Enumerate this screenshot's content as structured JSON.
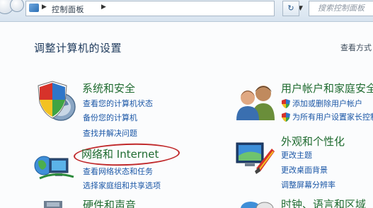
{
  "address_bar": {
    "path": "控制面板",
    "search_placeholder": "搜索控制面板"
  },
  "header": {
    "title": "调整计算机的设置",
    "view_by": "查看方式"
  },
  "categories": {
    "system_security": {
      "title": "系统和安全",
      "links": [
        "查看您的计算机状态",
        "备份您的计算机",
        "查找并解决问题"
      ]
    },
    "network": {
      "title": "网络和 Internet",
      "links": [
        "查看网络状态和任务",
        "选择家庭组和共享选项"
      ]
    },
    "hardware": {
      "title": "硬件和声音"
    },
    "user_accounts": {
      "title": "用户帐户和家庭安全",
      "links": [
        "添加或删除用户帐户",
        "为所有用户设置家长控制"
      ]
    },
    "appearance": {
      "title": "外观和个性化",
      "links": [
        "更改主题",
        "更改桌面背景",
        "调整屏幕分辨率"
      ]
    },
    "clock": {
      "title": "时钟、语言和区域"
    }
  },
  "colors": {
    "category_title": "#1f6b30",
    "link": "#1a56a6",
    "highlight": "#c0282a"
  }
}
